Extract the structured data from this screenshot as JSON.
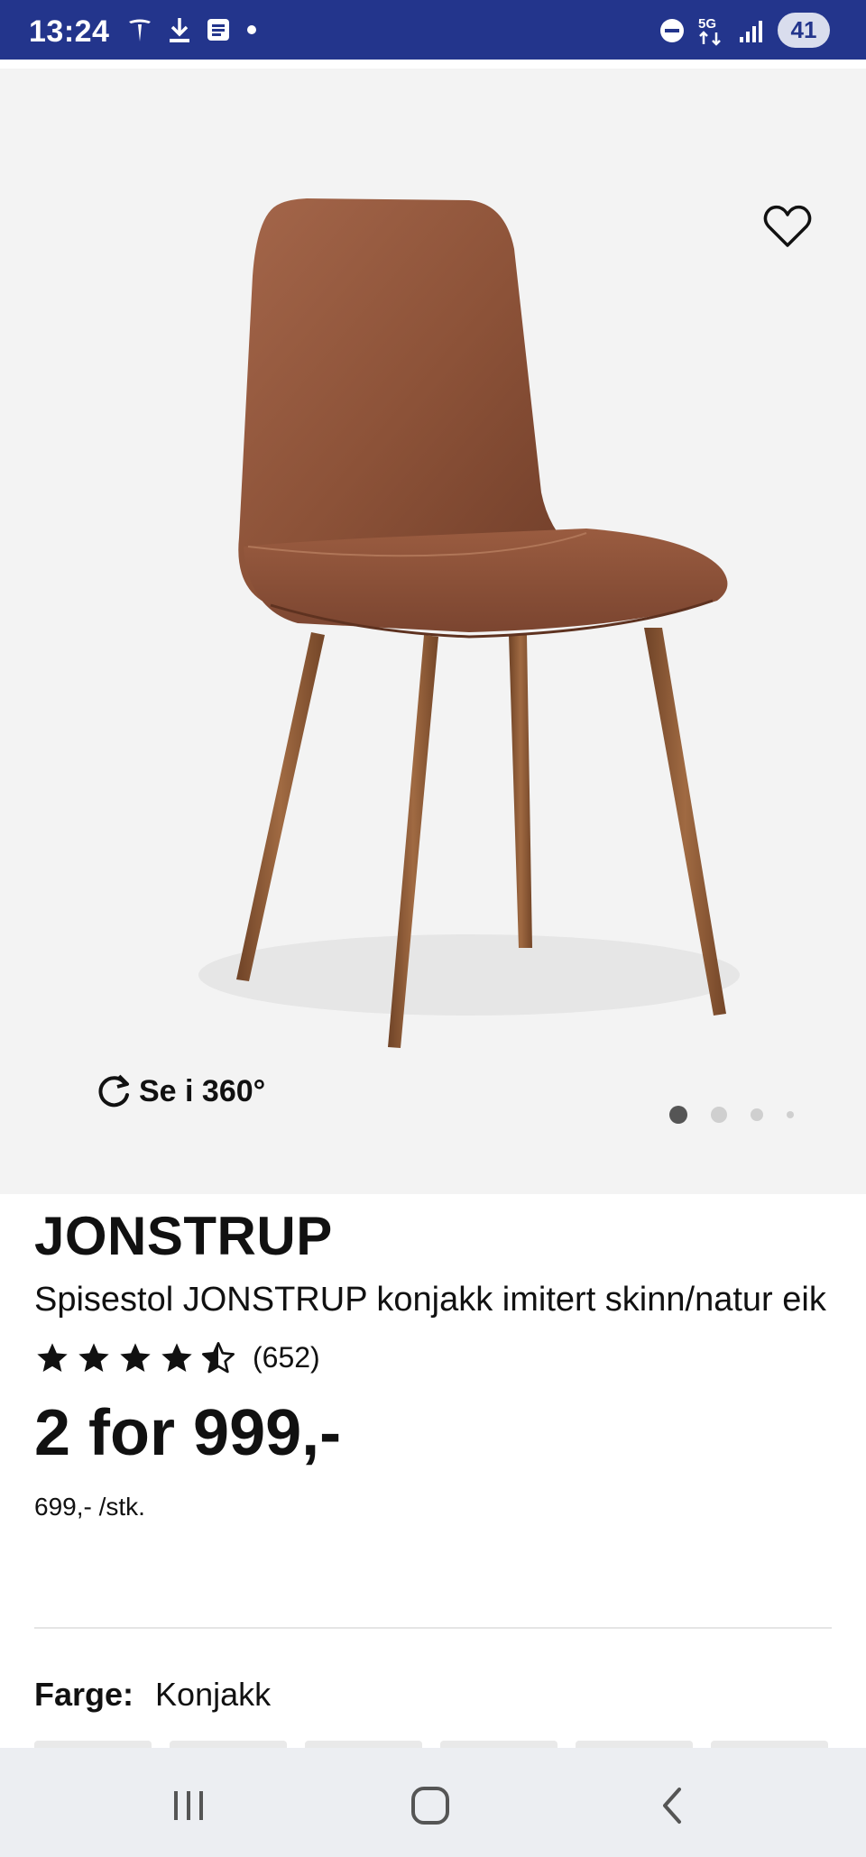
{
  "status_bar": {
    "time": "13:24",
    "left_icons": [
      "tesla-icon",
      "download-icon",
      "notes-icon",
      "dot-icon"
    ],
    "right_icons": [
      "dnd-icon",
      "network-5g-icon",
      "signal-icon"
    ],
    "battery": "41"
  },
  "gallery": {
    "rotate_label": "Se i 360°",
    "page_count": 4,
    "active_page": 1
  },
  "product": {
    "brand": "JONSTRUP",
    "description": "Spisestol JONSTRUP konjakk imitert skinn/natur eik",
    "rating": 4.5,
    "rating_count": "(652)",
    "price": "2 for 999,-",
    "unit_price": "699,- /stk.",
    "color_label": "Farge:",
    "color_value": "Konjakk"
  },
  "colors": {
    "status_bar": "#23358c",
    "gallery_bg": "#f3f3f3",
    "chair_leather": "#8a4f36",
    "chair_wood": "#8d5a37"
  }
}
